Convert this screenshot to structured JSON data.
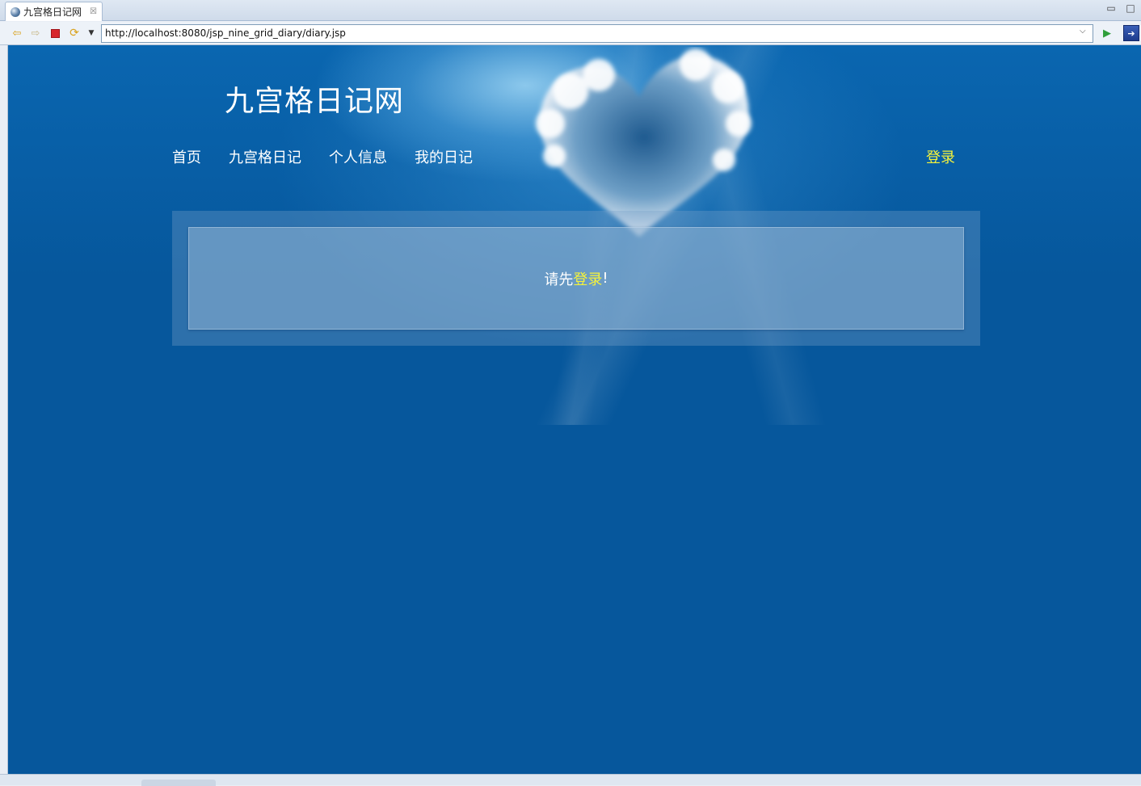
{
  "browser": {
    "tab_title": "九宫格日记网",
    "tab_close": "☒",
    "minimize": "▭",
    "maximize": "□",
    "url": "http://localhost:8080/jsp_nine_grid_diary/diary.jsp",
    "icons": {
      "back": "arrow-left-icon",
      "forward": "arrow-right-icon",
      "stop": "stop-icon",
      "refresh": "refresh-icon",
      "go": "play-icon"
    }
  },
  "site": {
    "title": "九宫格日记网",
    "nav": [
      {
        "label": "首页"
      },
      {
        "label": "九宫格日记"
      },
      {
        "label": "个人信息"
      },
      {
        "label": "我的日记"
      }
    ],
    "login_label": "登录"
  },
  "notice": {
    "prefix": "请先",
    "link": "登录",
    "suffix": "!"
  },
  "colors": {
    "page_bg": "#06579c",
    "highlight": "#f6f33a",
    "text": "#ffffff"
  }
}
